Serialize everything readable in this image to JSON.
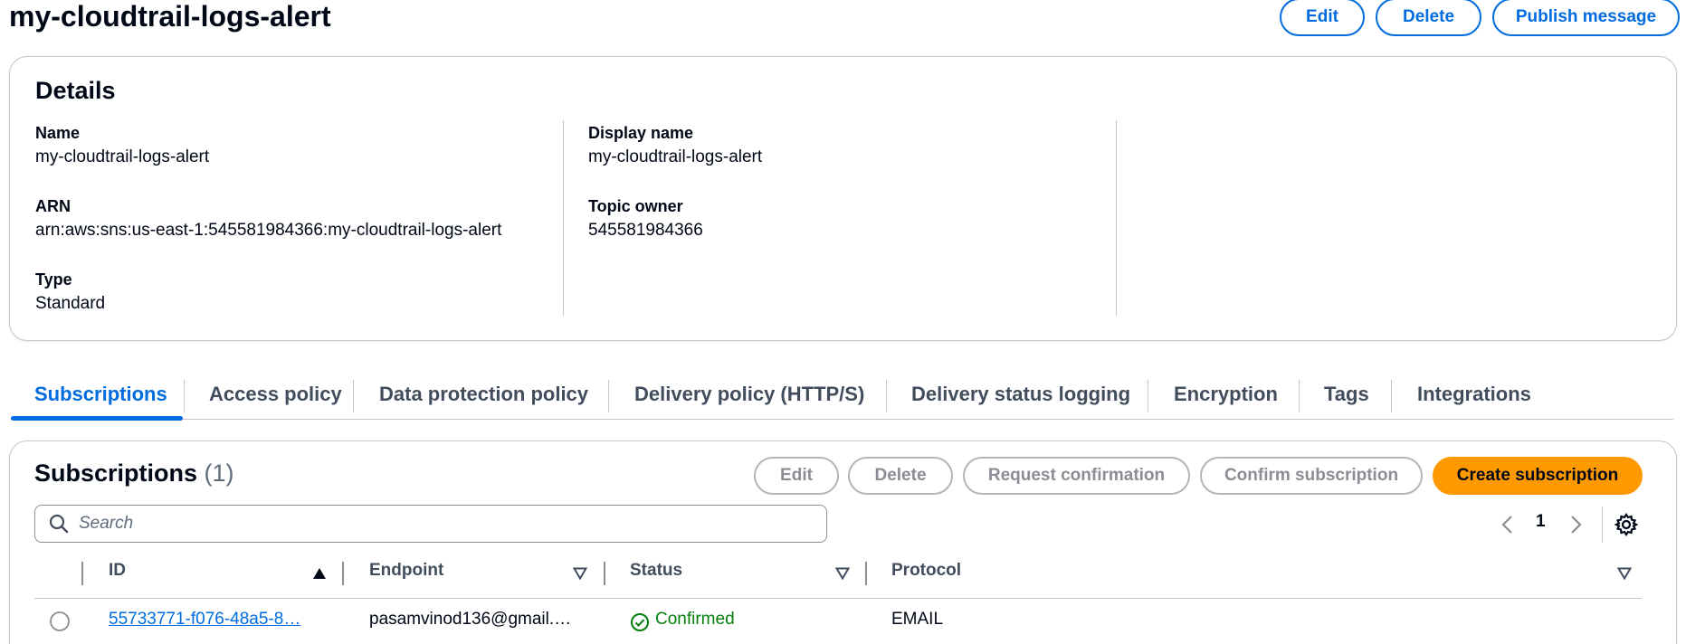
{
  "header": {
    "title": "my-cloudtrail-logs-alert",
    "buttons": {
      "edit": "Edit",
      "delete": "Delete",
      "publish": "Publish message"
    }
  },
  "details": {
    "heading": "Details",
    "name_label": "Name",
    "name_value": "my-cloudtrail-logs-alert",
    "arn_label": "ARN",
    "arn_value": "arn:aws:sns:us-east-1:545581984366:my-cloudtrail-logs-alert",
    "type_label": "Type",
    "type_value": "Standard",
    "display_name_label": "Display name",
    "display_name_value": "my-cloudtrail-logs-alert",
    "topic_owner_label": "Topic owner",
    "topic_owner_value": "545581984366"
  },
  "tabs": [
    {
      "label": "Subscriptions",
      "active": true
    },
    {
      "label": "Access policy"
    },
    {
      "label": "Data protection policy"
    },
    {
      "label": "Delivery policy (HTTP/S)"
    },
    {
      "label": "Delivery status logging"
    },
    {
      "label": "Encryption"
    },
    {
      "label": "Tags"
    },
    {
      "label": "Integrations"
    }
  ],
  "subscriptions": {
    "heading": "Subscriptions",
    "count": "(1)",
    "buttons": {
      "edit": "Edit",
      "delete": "Delete",
      "request_confirmation": "Request confirmation",
      "confirm_subscription": "Confirm subscription",
      "create_subscription": "Create subscription"
    },
    "search_placeholder": "Search",
    "page": "1",
    "columns": [
      "ID",
      "Endpoint",
      "Status",
      "Protocol"
    ],
    "rows": [
      {
        "id": "55733771-f076-48a5-8…",
        "endpoint": "pasamvinod136@gmail.…",
        "status": "Confirmed",
        "protocol": "EMAIL"
      }
    ]
  },
  "colors": {
    "link": "#006ce0",
    "primary_button": "#ff9900",
    "success": "#037f0c",
    "disabled": "#8c8c94"
  }
}
